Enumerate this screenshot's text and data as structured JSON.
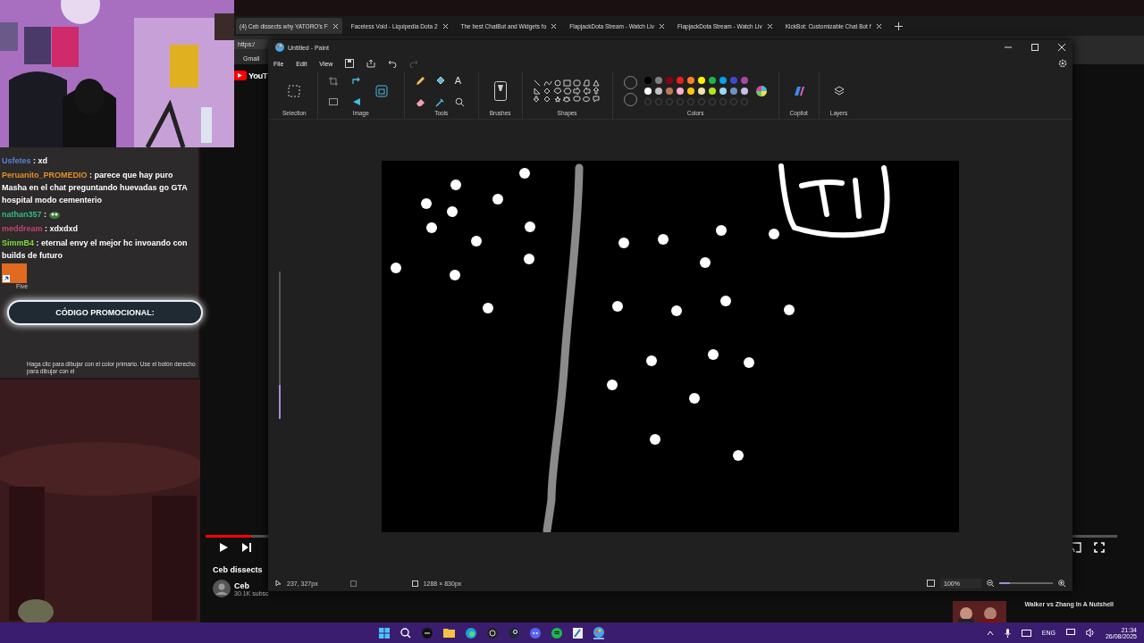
{
  "chat": {
    "messages": [
      {
        "user": "Usfetes",
        "color": "#5b7fd6",
        "kind": "text",
        "text": " : xd"
      },
      {
        "user": "Peruanito_PROMEDIO",
        "color": "#e0902a",
        "kind": "text",
        "text": " : parece que hay puro Masha en el chat preguntando huevadas go GTA hospital modo cementerio"
      },
      {
        "user": "nathan357",
        "color": "#2fbf7f",
        "kind": "emote",
        "text": " :"
      },
      {
        "user": "meddream",
        "color": "#c0456a",
        "kind": "text",
        "text": " : xdxdxd"
      },
      {
        "user": "SimmB4",
        "color": "#7ddc3a",
        "kind": "text",
        "text": " : eternal envy el mejor hc invoando con builds de futuro"
      }
    ],
    "shortcut_label": "Five",
    "promo": "CÓDIGO PROMOCIONAL:",
    "paint_hint": "Haga clic para dibujar con el color primario. Use el botón derecho para dibujar con el"
  },
  "browser": {
    "tabs": [
      {
        "title": "(4) Ceb dissects why YATORO's F",
        "selected": true
      },
      {
        "title": "Faceless Void - Liquipedia Dota 2",
        "selected": false
      },
      {
        "title": "The best ChatBot and Widgets fo",
        "selected": false
      },
      {
        "title": "FlapjackDota Stream - Watch Liv",
        "selected": false
      },
      {
        "title": "FlapjackDota Stream - Watch Liv",
        "selected": false
      },
      {
        "title": "KickBot: Customizable Chat Bot f",
        "selected": false
      }
    ],
    "address": "https:/",
    "bookmark": "Gmail",
    "site_logo": "YouT"
  },
  "video": {
    "progress": {
      "level": 0.05
    },
    "title": "Ceb dissects",
    "channel": "Ceb",
    "subscribers": "30.1K subsc",
    "recommended": "Walker vs Zhang In A Nutshell"
  },
  "paint": {
    "title": "Untitled - Paint",
    "menu": [
      "File",
      "Edit",
      "View"
    ],
    "groups": [
      "Selection",
      "Image",
      "Tools",
      "Brushes",
      "Shapes",
      "Colors",
      "Copilot",
      "Layers"
    ],
    "text_tool": "A",
    "palette": [
      {
        "color": "#000000"
      },
      {
        "color": "#7f7f7f"
      },
      {
        "color": "#880015"
      },
      {
        "color": "#ed1c24"
      },
      {
        "color": "#ff7f27"
      },
      {
        "color": "#fff200"
      },
      {
        "color": "#22b14c"
      },
      {
        "color": "#00a2e8"
      },
      {
        "color": "#3f48cc"
      },
      {
        "color": "#a349a4"
      },
      {
        "color": "#ffffff"
      },
      {
        "color": "#c3c3c3"
      },
      {
        "color": "#b97a57"
      },
      {
        "color": "#ffaec9"
      },
      {
        "color": "#ffc90e"
      },
      {
        "color": "#efe4b0"
      },
      {
        "color": "#b5e61d"
      },
      {
        "color": "#99d9ea"
      },
      {
        "color": "#7092be"
      },
      {
        "color": "#c8bfe7"
      }
    ],
    "brush_size": {
      "level": 0.23
    },
    "cursor_position": "237, 327px",
    "canvas_size": "1288 × 830px",
    "zoom": "100%",
    "zoom_slider": {
      "level": 0.2
    }
  },
  "taskbar": {
    "language": "ENG",
    "time": "21:34",
    "date": "26/08/2025"
  }
}
